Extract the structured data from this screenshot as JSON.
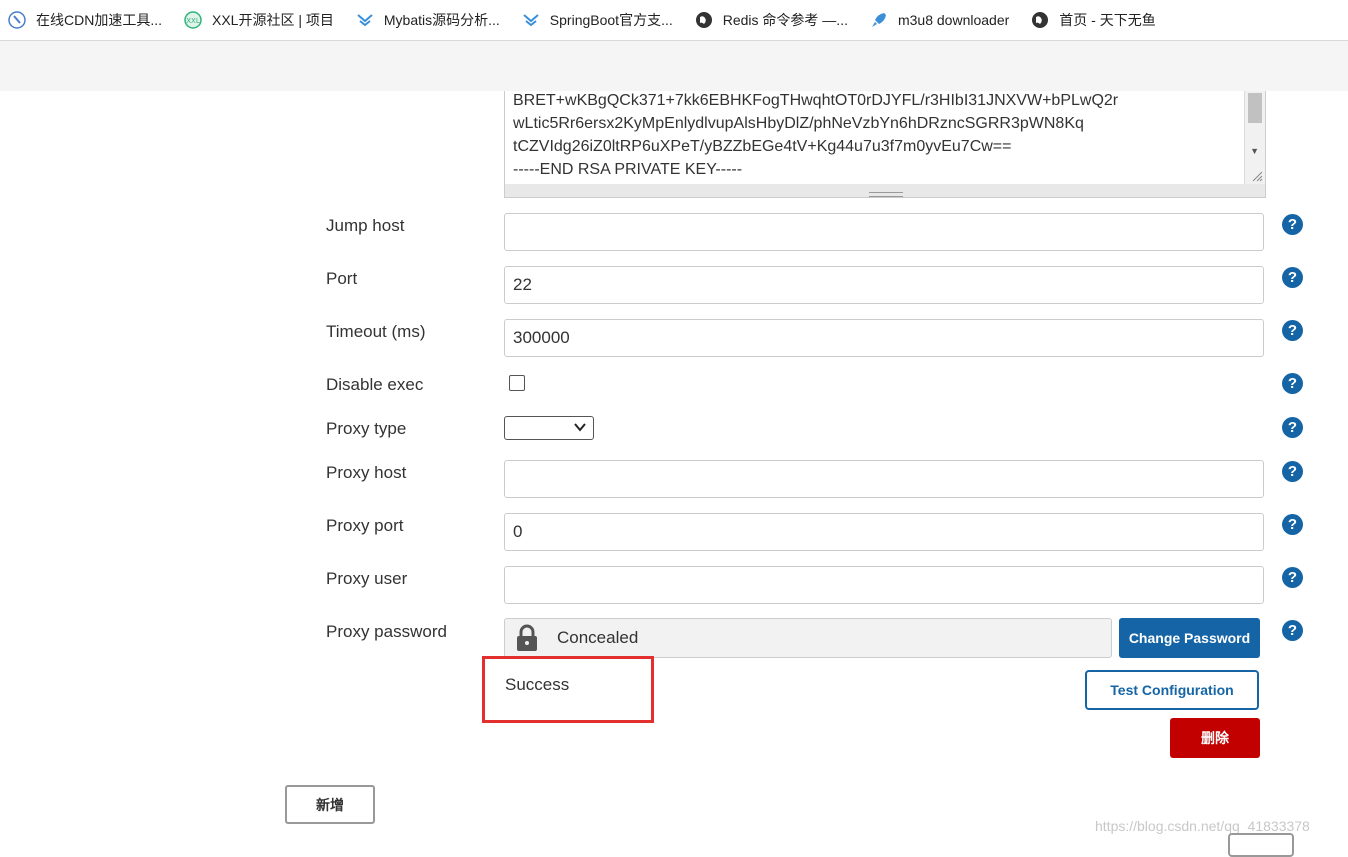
{
  "bookmarks": [
    {
      "label": "在线CDN加速工具...",
      "icon": "cdn-tool-icon"
    },
    {
      "label": "XXL开源社区 | 项目",
      "icon": "xxl-icon"
    },
    {
      "label": "Mybatis源码分析...",
      "icon": "chevron-layer-icon"
    },
    {
      "label": "SpringBoot官方支...",
      "icon": "chevron-layer-icon"
    },
    {
      "label": "Redis 命令参考 —...",
      "icon": "globe-icon"
    },
    {
      "label": "m3u8 downloader",
      "icon": "rocket-icon"
    },
    {
      "label": "首页 - 天下无鱼",
      "icon": "globe-icon"
    }
  ],
  "private_key": {
    "lines": [
      "BRET+wKBgQCk371+7kk6EBHKFogTHwqhtOT0rDJYFL/r3HIbI31JNXVW+bPLwQ2r",
      "wLtic5Rr6ersx2KyMpEnlydlvupAlsHbyDlZ/phNeVzbYn6hDRzncSGRR3pWN8Kq",
      "tCZVIdg26iZ0ltRP6uXPeT/yBZZbEGe4tV+Kg44u7u3f7m0yvEu7Cw==",
      "-----END RSA PRIVATE KEY-----"
    ]
  },
  "fields": {
    "jump_host": {
      "label": "Jump host",
      "value": ""
    },
    "port": {
      "label": "Port",
      "value": "22"
    },
    "timeout": {
      "label": "Timeout (ms)",
      "value": "300000"
    },
    "disable_exec": {
      "label": "Disable exec",
      "checked": false
    },
    "proxy_type": {
      "label": "Proxy type",
      "value": ""
    },
    "proxy_host": {
      "label": "Proxy host",
      "value": ""
    },
    "proxy_port": {
      "label": "Proxy port",
      "value": "0"
    },
    "proxy_user": {
      "label": "Proxy user",
      "value": ""
    },
    "proxy_password": {
      "label": "Proxy password",
      "value": "Concealed"
    }
  },
  "help_glyph": "?",
  "buttons": {
    "change_password": "Change Password",
    "test_configuration": "Test Configuration",
    "delete": "删除",
    "add": "新增"
  },
  "status": {
    "test_result": "Success"
  },
  "watermark": "https://blog.csdn.net/qq_41833378",
  "colors": {
    "primary": "#1565a6",
    "danger": "#c20000",
    "highlight_box": "#e3302f"
  }
}
